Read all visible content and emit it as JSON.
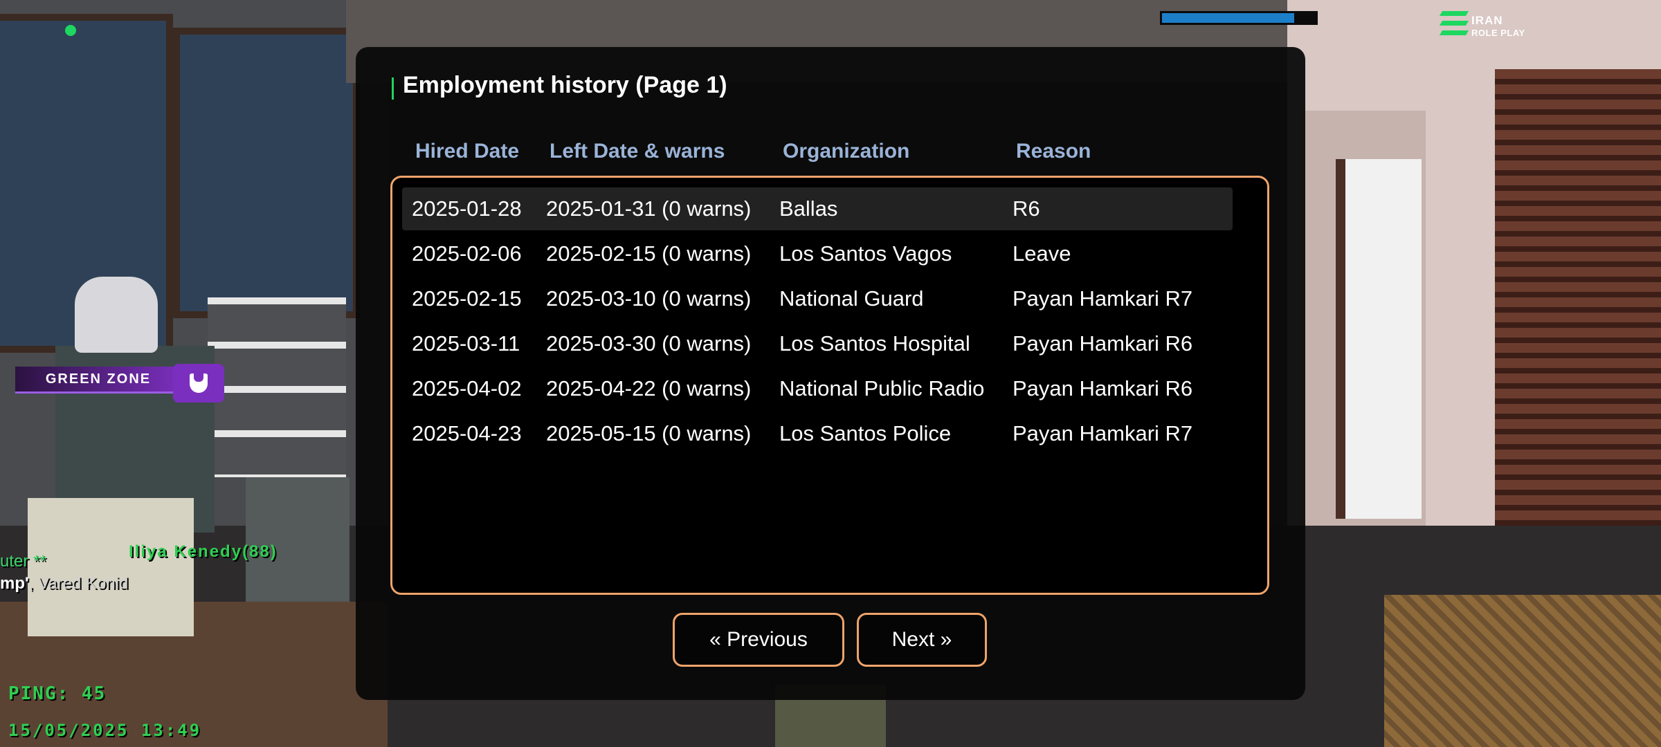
{
  "hud": {
    "player_name": "Iliya Kenedy(88)",
    "chat_line_1": "uter **",
    "chat_line_2_bold": "mp'",
    "chat_line_2_rest": ", Vared Konid",
    "ping_label": "PING: 45",
    "datetime": "15/05/2025 13:49",
    "zone_label": "GREEN ZONE",
    "zone_icon": "shield-icon",
    "top_bar_fill": 0.86,
    "logo_line_1": "IRAN",
    "logo_line_2": "ROLE PLAY",
    "colors": {
      "hud_green": "#2fcf52",
      "zone_purple": "#7b2fbe",
      "bar_blue": "#1e7fc9"
    }
  },
  "dialog": {
    "title": "Employment history (Page 1)",
    "columns": [
      "Hired Date",
      "Left Date & warns",
      "Organization",
      "Reason"
    ],
    "rows": [
      [
        "2025-01-28",
        "2025-01-31 (0 warns)",
        "Ballas",
        "R6"
      ],
      [
        "2025-02-06",
        "2025-02-15 (0 warns)",
        "Los Santos Vagos",
        "Leave"
      ],
      [
        "2025-02-15",
        "2025-03-10 (0 warns)",
        "National Guard",
        "Payan Hamkari R7"
      ],
      [
        "2025-03-11",
        "2025-03-30 (0 warns)",
        "Los Santos Hospital",
        "Payan Hamkari R6"
      ],
      [
        "2025-04-02",
        "2025-04-22 (0 warns)",
        "National Public Radio",
        "Payan Hamkari R6"
      ],
      [
        "2025-04-23",
        "2025-05-15 (0 warns)",
        "Los Santos Police",
        "Payan Hamkari R7"
      ]
    ],
    "selected_row": 0,
    "prev_label": "« Previous",
    "next_label": "Next »",
    "colors": {
      "accent_orange": "#f0a46a",
      "header_blue": "#9ab3d8",
      "title_accent": "#1ed760"
    }
  }
}
